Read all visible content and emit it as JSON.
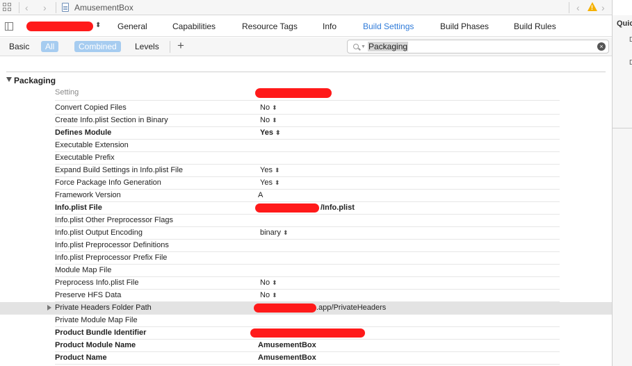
{
  "jumpbar": {
    "back_glyph": "‹",
    "forward_glyph": "›",
    "file_name": "AmusementBox",
    "nav_left_glyph": "‹",
    "nav_right_glyph": "›",
    "warning_glyph": "!"
  },
  "inspector": {
    "title": "Quick",
    "item1": "D",
    "item2": "D"
  },
  "tabbar": {
    "target_updown": "⬍",
    "tabs": [
      "General",
      "Capabilities",
      "Resource Tags",
      "Info",
      "Build Settings",
      "Build Phases",
      "Build Rules"
    ],
    "active_tab": "Build Settings"
  },
  "filterbar": {
    "basic": "Basic",
    "all": "All",
    "combined": "Combined",
    "levels": "Levels",
    "add": "+",
    "search_value": "Packaging",
    "clear": "×"
  },
  "section": {
    "title": "Packaging"
  },
  "settings": {
    "header": {
      "name": "Setting",
      "value": ""
    },
    "rows": [
      {
        "name": "Convert Copied Files",
        "value": "No",
        "stepper": "⬍"
      },
      {
        "name": "Create Info.plist Section in Binary",
        "value": "No",
        "stepper": "⬍"
      },
      {
        "name": "Defines Module",
        "value": "Yes",
        "stepper": "⬍"
      },
      {
        "name": "Executable Extension",
        "value": ""
      },
      {
        "name": "Executable Prefix",
        "value": ""
      },
      {
        "name": "Expand Build Settings in Info.plist File",
        "value": "Yes",
        "stepper": "⬍"
      },
      {
        "name": "Force Package Info Generation",
        "value": "Yes",
        "stepper": "⬍"
      },
      {
        "name": "Framework Version",
        "value": "A"
      },
      {
        "name": "Info.plist File",
        "value": "/Info.plist"
      },
      {
        "name": "Info.plist Other Preprocessor Flags",
        "value": ""
      },
      {
        "name": "Info.plist Output Encoding",
        "value": "binary",
        "stepper": "⬍"
      },
      {
        "name": "Info.plist Preprocessor Definitions",
        "value": ""
      },
      {
        "name": "Info.plist Preprocessor Prefix File",
        "value": ""
      },
      {
        "name": "Module Map File",
        "value": ""
      },
      {
        "name": "Preprocess Info.plist File",
        "value": "No",
        "stepper": "⬍"
      },
      {
        "name": "Preserve HFS Data",
        "value": "No",
        "stepper": "⬍"
      },
      {
        "name": "Private Headers Folder Path",
        "value": ".app/PrivateHeaders"
      },
      {
        "name": "Private Module Map File",
        "value": ""
      },
      {
        "name": "Product Bundle Identifier",
        "value": ""
      },
      {
        "name": "Product Module Name",
        "value": "AmusementBox"
      },
      {
        "name": "Product Name",
        "value": "AmusementBox"
      }
    ]
  },
  "colors": {
    "accent": "#2f7bd9",
    "redaction": "#ff1a1a",
    "pill": "#a6ccf0",
    "warning": "#f5b100"
  }
}
